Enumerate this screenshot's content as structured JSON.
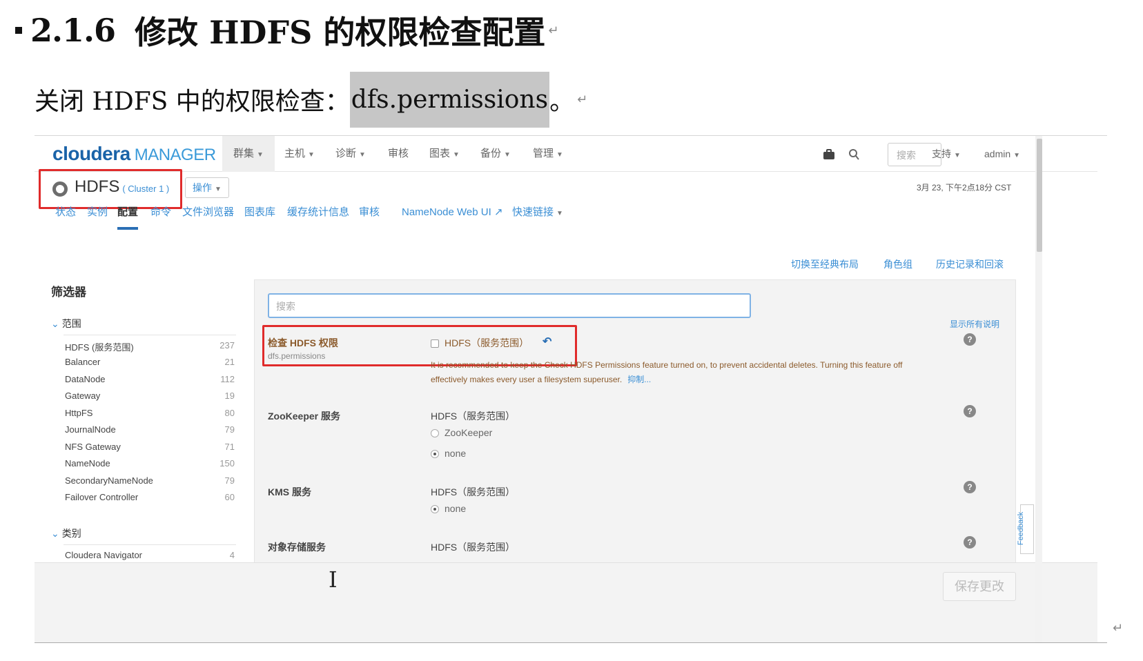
{
  "doc": {
    "heading_number": "2.1.6",
    "heading_title": "修改 HDFS 的权限检查配置",
    "para_text": "关闭 HDFS 中的权限检查：",
    "para_highlight": "dfs.permissions",
    "para_end": "。",
    "para_mark": "↵"
  },
  "cm": {
    "logo_brand": "cloudera",
    "logo_product": "MANAGER",
    "nav": [
      {
        "label": "群集",
        "active": true
      },
      {
        "label": "主机"
      },
      {
        "label": "诊断"
      },
      {
        "label": "审核"
      },
      {
        "label": "图表"
      },
      {
        "label": "备份"
      },
      {
        "label": "管理"
      }
    ],
    "search_placeholder": "搜索",
    "support": "支持",
    "user": "admin",
    "service_name": "HDFS",
    "cluster_label": "( Cluster 1 )",
    "actions_label": "操作",
    "timestamp": "3月 23, 下午2点18分 CST",
    "tabs": [
      "状态",
      "实例",
      "配置",
      "命令",
      "文件浏览器",
      "图表库",
      "缓存统计信息",
      "审核",
      "NameNode Web UI",
      "快速链接"
    ],
    "active_tab": "配置",
    "right_links": [
      "切换至经典布局",
      "角色组",
      "历史记录和回滚"
    ],
    "filter_title": "筛选器",
    "scope_heading": "范围",
    "scope_items": [
      {
        "label": "HDFS (服务范围)",
        "count": "237"
      },
      {
        "label": "Balancer",
        "count": "21"
      },
      {
        "label": "DataNode",
        "count": "112"
      },
      {
        "label": "Gateway",
        "count": "19"
      },
      {
        "label": "HttpFS",
        "count": "80"
      },
      {
        "label": "JournalNode",
        "count": "79"
      },
      {
        "label": "NFS Gateway",
        "count": "71"
      },
      {
        "label": "NameNode",
        "count": "150"
      },
      {
        "label": "SecondaryNameNode",
        "count": "79"
      },
      {
        "label": "Failover Controller",
        "count": "60"
      }
    ],
    "category_heading": "类别",
    "category_items": [
      {
        "label": "Cloudera Navigator",
        "count": "4"
      }
    ],
    "config_search_placeholder": "搜索",
    "show_all_desc": "显示所有说明",
    "configs": [
      {
        "label": "检查 HDFS 权限",
        "key": "dfs.permissions",
        "scope": "HDFS（服务范围）",
        "message": "It is recommended to keep the Check HDFS Permissions feature turned on, to prevent accidental deletes. Turning this feature off effectively makes every user a filesystem superuser.",
        "more": "抑制..."
      },
      {
        "label": "ZooKeeper 服务",
        "scope": "HDFS（服务范围）",
        "options": [
          "ZooKeeper",
          "none"
        ],
        "selected": "none"
      },
      {
        "label": "KMS 服务",
        "scope": "HDFS（服务范围）",
        "options": [
          "none"
        ],
        "selected": "none"
      },
      {
        "label": "对象存储服务",
        "scope": "HDFS（服务范围）"
      }
    ],
    "save_label": "保存更改",
    "feedback_label": "Feedback"
  },
  "colors": {
    "brand": "#1a63a8",
    "link": "#3a8ed4",
    "highlight_box": "#e02b2b",
    "warning_text": "#8b5a2b"
  }
}
